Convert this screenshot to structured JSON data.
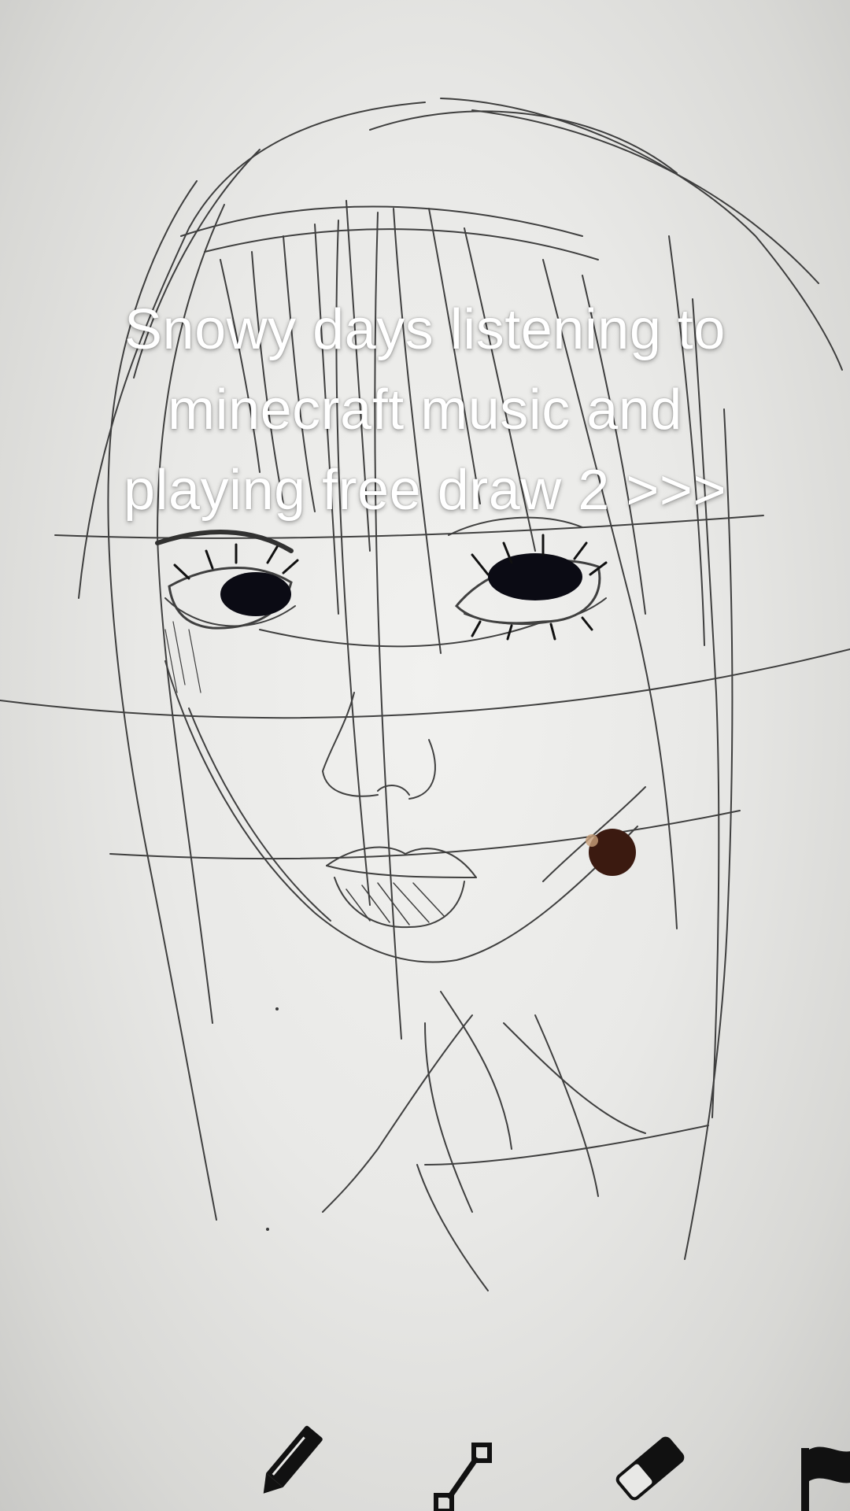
{
  "caption": {
    "line1": "Snowy days listening to",
    "line2": "minecraft music and",
    "line3": "playing free draw 2 >>>"
  },
  "toolbar": {
    "tools": [
      {
        "icon": "pencil-icon"
      },
      {
        "icon": "line-tool-icon"
      },
      {
        "icon": "eraser-icon"
      },
      {
        "icon": "flag-icon"
      }
    ]
  },
  "colors": {
    "ink": "#1a1a1a",
    "ink_dot": "#3b1a10",
    "caption_text": "#ffffff",
    "canvas": "#ececea"
  }
}
